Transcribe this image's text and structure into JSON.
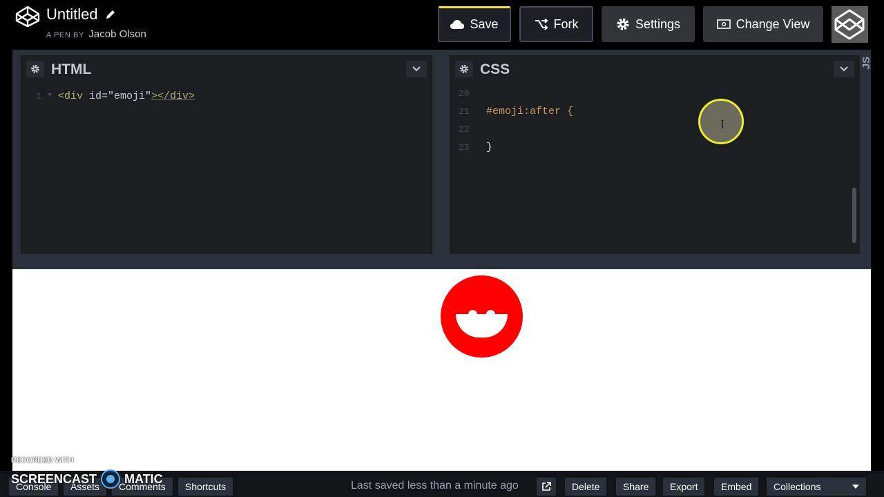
{
  "header": {
    "pen_title": "Untitled",
    "byline_prefix": "A PEN BY",
    "author": "Jacob Olson",
    "save_label": "Save",
    "fork_label": "Fork",
    "settings_label": "Settings",
    "change_view_label": "Change View"
  },
  "editors": {
    "html": {
      "title": "HTML",
      "lines": [
        {
          "num": "1",
          "tokens": {
            "open": "<div ",
            "attr": "id=",
            "str": "\"emoji\"",
            "close": "></div>"
          }
        }
      ]
    },
    "css": {
      "title": "CSS",
      "lines": [
        {
          "num": "20",
          "text": ""
        },
        {
          "num": "21",
          "text": "#emoji:after {"
        },
        {
          "num": "22",
          "text": ""
        },
        {
          "num": "23",
          "text": "}"
        }
      ]
    },
    "js_tab": "JS"
  },
  "footer": {
    "console": "Console",
    "assets": "Assets",
    "comments": "Comments",
    "shortcuts": "Shortcuts",
    "saved_status": "Last saved less than a minute ago",
    "delete": "Delete",
    "share": "Share",
    "export": "Export",
    "embed": "Embed",
    "collections": "Collections"
  },
  "watermark": {
    "top": "RECORDED WITH",
    "left": "SCREENCAST",
    "right": "MATIC"
  },
  "colors": {
    "emoji": "#ff0000",
    "save_accent": "#ffdd40",
    "cursor_ring": "#ecec2c"
  }
}
